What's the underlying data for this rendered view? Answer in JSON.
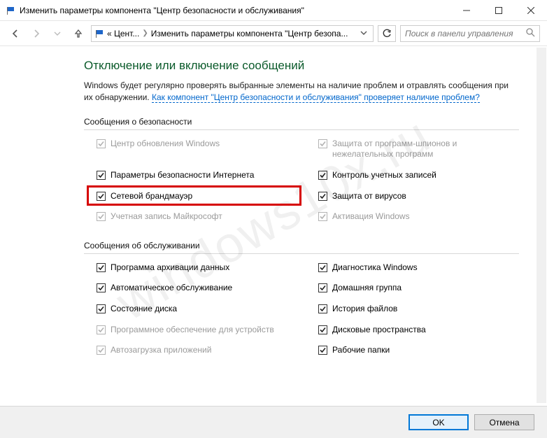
{
  "window": {
    "title": "Изменить параметры компонента \"Центр безопасности и обслуживания\""
  },
  "breadcrumb": {
    "part1": "« Цент...",
    "part2": "Изменить параметры компонента \"Центр безопа..."
  },
  "search": {
    "placeholder": "Поиск в панели управления"
  },
  "page": {
    "heading": "Отключение или включение сообщений",
    "intro_plain": "Windows будет регулярно проверять выбранные элементы на наличие проблем и отравлять сообщения при их обнаружении. ",
    "intro_link": "Как компонент \"Центр безопасности и обслуживания\" проверяет наличие проблем?"
  },
  "sections": {
    "security": {
      "title": "Сообщения о безопасности",
      "items": [
        {
          "label": "Центр обновления Windows",
          "checked": true,
          "disabled": true
        },
        {
          "label": "Защита от программ-шпионов и нежелательных программ",
          "checked": true,
          "disabled": true
        },
        {
          "label": "Параметры безопасности Интернета",
          "checked": true,
          "disabled": false
        },
        {
          "label": "Контроль учетных записей",
          "checked": true,
          "disabled": false
        },
        {
          "label": "Сетевой брандмауэр",
          "checked": true,
          "disabled": false
        },
        {
          "label": "Защита от вирусов",
          "checked": true,
          "disabled": false
        },
        {
          "label": "Учетная запись Майкрософт",
          "checked": true,
          "disabled": true
        },
        {
          "label": "Активация Windows",
          "checked": true,
          "disabled": true
        }
      ]
    },
    "maintenance": {
      "title": "Сообщения об обслуживании",
      "items": [
        {
          "label": "Программа архивации данных",
          "checked": true,
          "disabled": false
        },
        {
          "label": "Диагностика Windows",
          "checked": true,
          "disabled": false
        },
        {
          "label": "Автоматическое обслуживание",
          "checked": true,
          "disabled": false
        },
        {
          "label": "Домашняя группа",
          "checked": true,
          "disabled": false
        },
        {
          "label": "Состояние диска",
          "checked": true,
          "disabled": false
        },
        {
          "label": "История файлов",
          "checked": true,
          "disabled": false
        },
        {
          "label": "Программное обеспечение для устройств",
          "checked": true,
          "disabled": true
        },
        {
          "label": "Дисковые пространства",
          "checked": true,
          "disabled": false
        },
        {
          "label": "Автозагрузка приложений",
          "checked": true,
          "disabled": true
        },
        {
          "label": "Рабочие папки",
          "checked": true,
          "disabled": false
        }
      ]
    }
  },
  "buttons": {
    "ok": "OK",
    "cancel": "Отмена"
  },
  "watermark": "windows10x.ru",
  "highlight": {
    "section": "security",
    "index": 4
  }
}
